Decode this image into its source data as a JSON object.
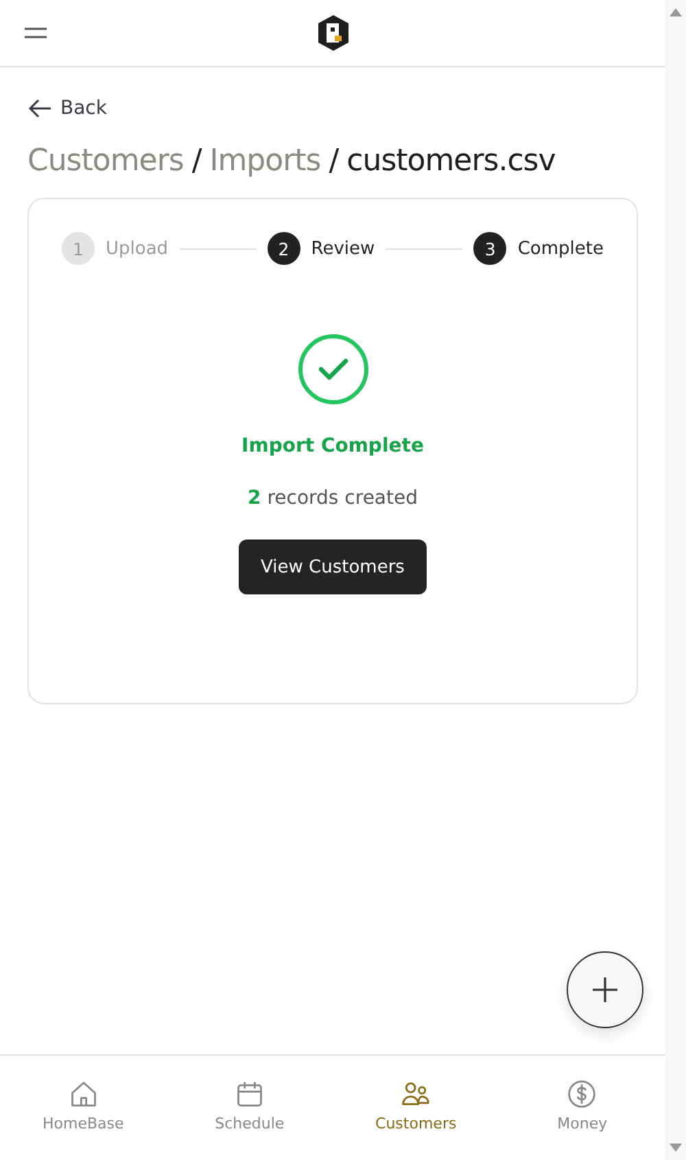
{
  "back": {
    "label": "Back"
  },
  "breadcrumb": [
    {
      "label": "Customers",
      "current": false
    },
    {
      "separator": "/",
      "label": "Imports",
      "current": false
    },
    {
      "separator": "/",
      "label": "customers.csv",
      "current": true
    }
  ],
  "steps": [
    {
      "number": "1",
      "label": "Upload",
      "active": false
    },
    {
      "number": "2",
      "label": "Review",
      "active": true
    },
    {
      "number": "3",
      "label": "Complete",
      "active": true
    }
  ],
  "result": {
    "title": "Import Complete",
    "count": "2",
    "text": "records created",
    "button": "View Customers"
  },
  "nav": [
    {
      "kind": "home",
      "label": "HomeBase",
      "selected": false
    },
    {
      "kind": "calendar",
      "label": "Schedule",
      "selected": false
    },
    {
      "kind": "people",
      "label": "Customers",
      "selected": true
    },
    {
      "kind": "money",
      "label": "Money",
      "selected": false
    }
  ]
}
